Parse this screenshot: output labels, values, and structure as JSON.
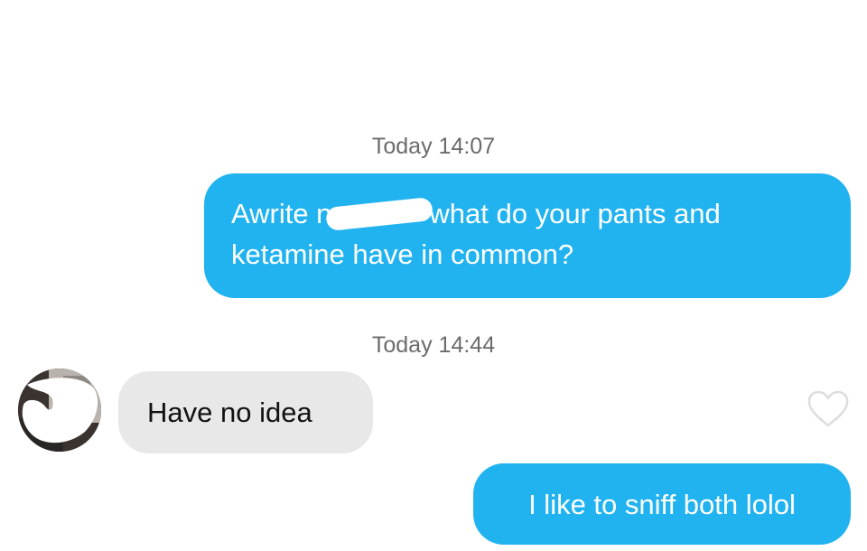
{
  "conversation": {
    "timestamps": [
      {
        "day": "Today",
        "time": "14:07"
      },
      {
        "day": "Today",
        "time": "14:44"
      }
    ],
    "messages": [
      {
        "direction": "sent",
        "line1_before": "Awrite n",
        "line1_after": "what do your pants and",
        "line2": "ketamine have in common?"
      },
      {
        "direction": "received",
        "text": "Have no idea"
      },
      {
        "direction": "sent",
        "text": "I like to sniff both lolol"
      }
    ]
  },
  "icons": {
    "like": "heart-outline-icon",
    "contact": "avatar"
  },
  "colors": {
    "sent_bubble": "#21b3f0",
    "received_bubble": "#e8e8e8",
    "timestamp": "#6b6b6b",
    "heart_outline": "#dddddd"
  }
}
